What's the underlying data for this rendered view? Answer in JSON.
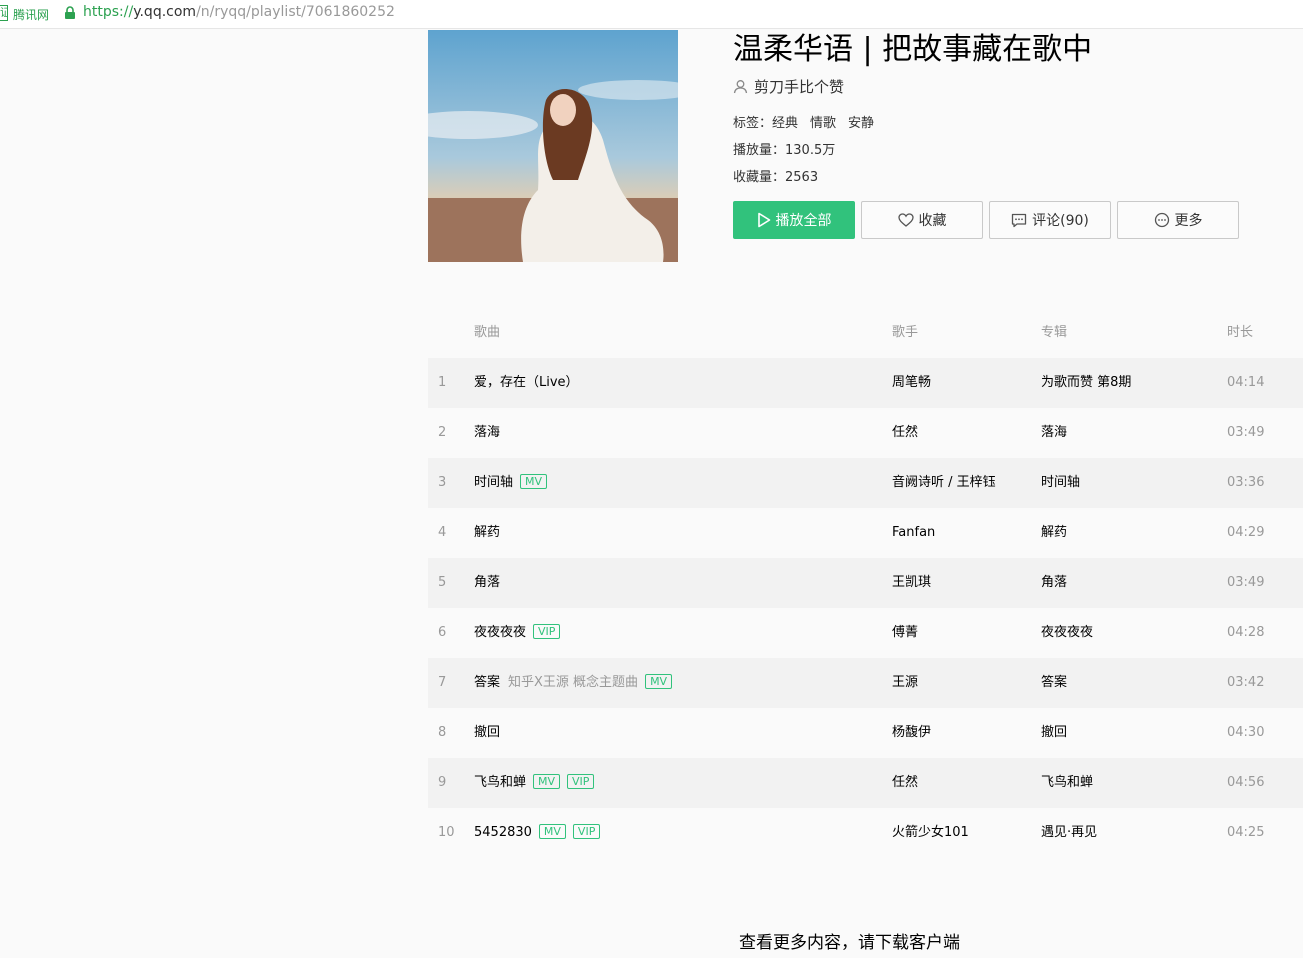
{
  "browser": {
    "cert_label": "腾讯网",
    "url_scheme": "https://",
    "url_host": "y.qq.com",
    "url_path": "/n/ryqq/playlist/7061860252"
  },
  "playlist": {
    "title": "温柔华语 | 把故事藏在歌中",
    "creator": "剪刀手比个赞",
    "tags_label": "标签：",
    "tags": [
      "经典",
      "情歌",
      "安静"
    ],
    "plays_label": "播放量：",
    "plays": "130.5万",
    "favs_label": "收藏量：",
    "favs": "2563"
  },
  "actions": {
    "play_all": "播放全部",
    "collect": "收藏",
    "comment": "评论(90)",
    "more": "更多"
  },
  "colors": {
    "accent": "#31c27c",
    "muted": "#999999"
  },
  "table": {
    "headers": {
      "song": "歌曲",
      "singer": "歌手",
      "album": "专辑",
      "duration": "时长"
    },
    "rows": [
      {
        "num": "1",
        "song": "爱，存在（Live）",
        "sub": "",
        "badges": [],
        "singer": "周笔畅",
        "album": "为歌而赞 第8期",
        "duration": "04:14"
      },
      {
        "num": "2",
        "song": "落海",
        "sub": "",
        "badges": [],
        "singer": "任然",
        "album": "落海",
        "duration": "03:49"
      },
      {
        "num": "3",
        "song": "时间轴",
        "sub": "",
        "badges": [
          "MV"
        ],
        "singer": "音阙诗听 / 王梓钰",
        "album": "时间轴",
        "duration": "03:36"
      },
      {
        "num": "4",
        "song": "解药",
        "sub": "",
        "badges": [],
        "singer": "Fanfan",
        "album": "解药",
        "duration": "04:29"
      },
      {
        "num": "5",
        "song": "角落",
        "sub": "",
        "badges": [],
        "singer": "王凯琪",
        "album": "角落",
        "duration": "03:49"
      },
      {
        "num": "6",
        "song": "夜夜夜夜",
        "sub": "",
        "badges": [
          "VIP"
        ],
        "singer": "傅菁",
        "album": "夜夜夜夜",
        "duration": "04:28"
      },
      {
        "num": "7",
        "song": "答案",
        "sub": "知乎X王源 概念主题曲",
        "badges": [
          "MV"
        ],
        "singer": "王源",
        "album": "答案",
        "duration": "03:42"
      },
      {
        "num": "8",
        "song": "撤回",
        "sub": "",
        "badges": [],
        "singer": "杨馥伊",
        "album": "撤回",
        "duration": "04:30"
      },
      {
        "num": "9",
        "song": "飞鸟和蝉",
        "sub": "",
        "badges": [
          "MV",
          "VIP"
        ],
        "singer": "任然",
        "album": "飞鸟和蝉",
        "duration": "04:56"
      },
      {
        "num": "10",
        "song": "5452830",
        "sub": "",
        "badges": [
          "MV",
          "VIP"
        ],
        "singer": "火箭少女101",
        "album": "遇见·再见",
        "duration": "04:25"
      }
    ]
  },
  "footer": {
    "text": "查看更多内容，请下载客户端"
  }
}
